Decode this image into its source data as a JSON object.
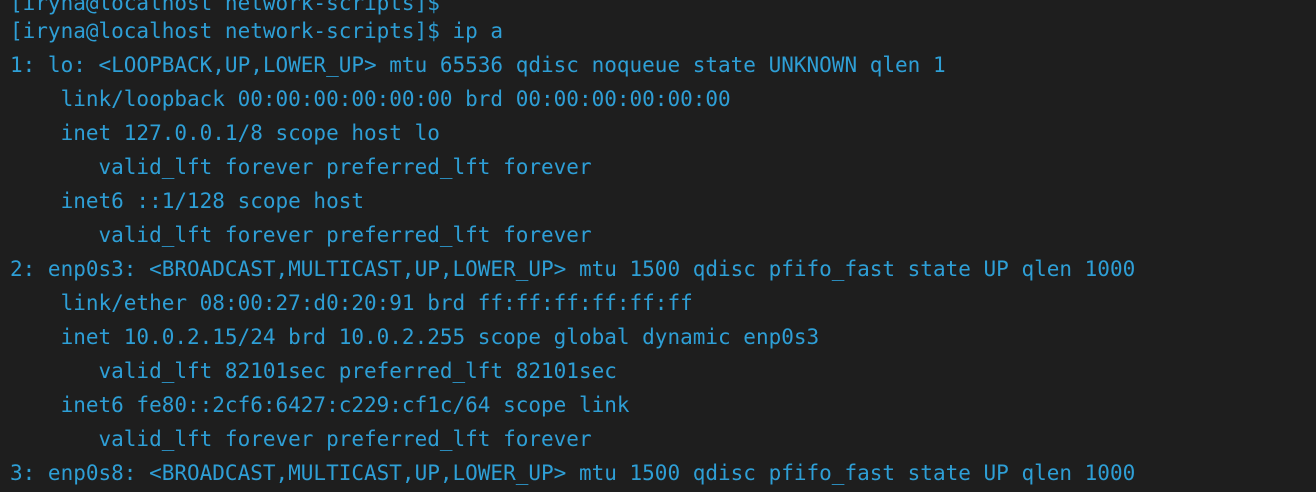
{
  "theme": {
    "background": "#1e1e1e",
    "text_color": "#2e9fd6"
  },
  "terminal": {
    "lines": [
      "[iryna@localhost network-scripts]$",
      "[iryna@localhost network-scripts]$ ip a",
      "1: lo: <LOOPBACK,UP,LOWER_UP> mtu 65536 qdisc noqueue state UNKNOWN qlen 1",
      "    link/loopback 00:00:00:00:00:00 brd 00:00:00:00:00:00",
      "    inet 127.0.0.1/8 scope host lo",
      "       valid_lft forever preferred_lft forever",
      "    inet6 ::1/128 scope host",
      "       valid_lft forever preferred_lft forever",
      "2: enp0s3: <BROADCAST,MULTICAST,UP,LOWER_UP> mtu 1500 qdisc pfifo_fast state UP qlen 1000",
      "    link/ether 08:00:27:d0:20:91 brd ff:ff:ff:ff:ff:ff",
      "    inet 10.0.2.15/24 brd 10.0.2.255 scope global dynamic enp0s3",
      "       valid_lft 82101sec preferred_lft 82101sec",
      "    inet6 fe80::2cf6:6427:c229:cf1c/64 scope link",
      "       valid_lft forever preferred_lft forever",
      "3: enp0s8: <BROADCAST,MULTICAST,UP,LOWER_UP> mtu 1500 qdisc pfifo_fast state UP qlen 1000"
    ]
  }
}
